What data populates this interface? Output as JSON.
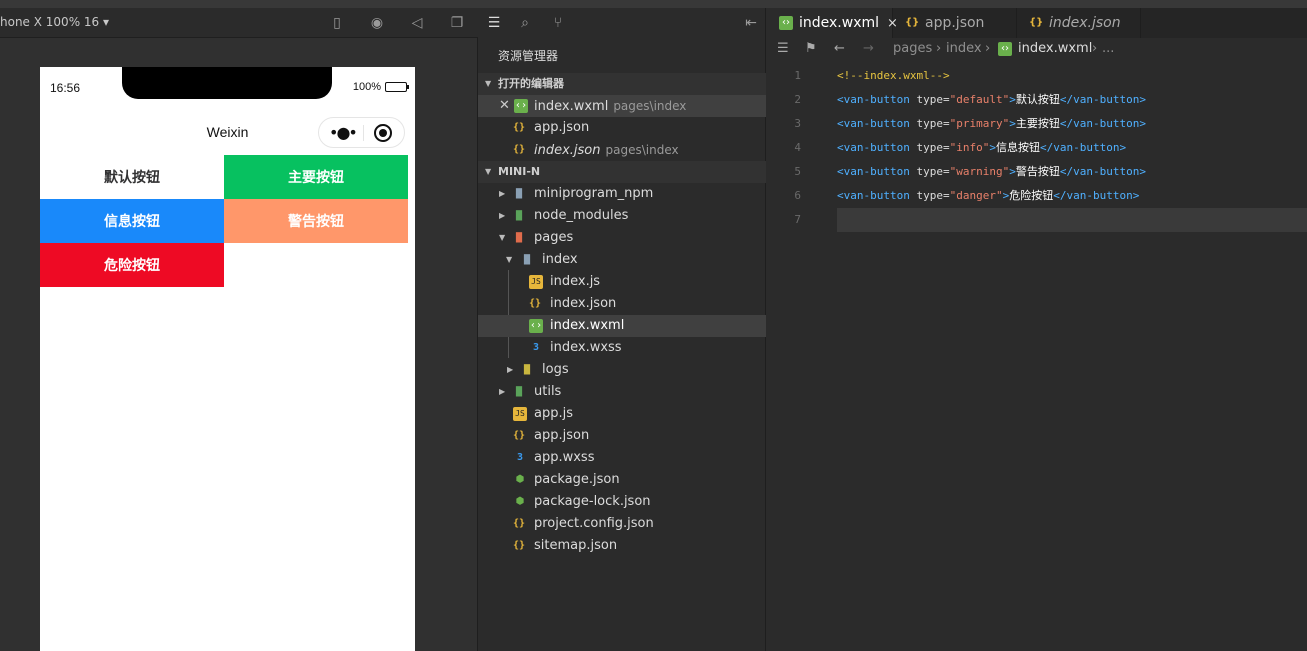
{
  "simulator": {
    "device_label": "hone X 100% 16 ▾",
    "status_time": "16:56",
    "status_battery": "100%",
    "nav_title": "Weixin",
    "buttons": {
      "default": "默认按钮",
      "primary": "主要按钮",
      "info": "信息按钮",
      "warning": "警告按钮",
      "danger": "危险按钮"
    }
  },
  "explorer": {
    "title": "资源管理器",
    "open_editors_header": "打开的编辑器",
    "open_editors": [
      {
        "name": "index.wxml",
        "path": "pages\\index"
      },
      {
        "name": "app.json",
        "path": ""
      },
      {
        "name": "index.json",
        "path": "pages\\index"
      }
    ],
    "project_header": "MINI-N",
    "tree": [
      {
        "name": "miniprogram_npm"
      },
      {
        "name": "node_modules"
      },
      {
        "name": "pages"
      },
      {
        "name": "index"
      },
      {
        "name": "index.js"
      },
      {
        "name": "index.json"
      },
      {
        "name": "index.wxml"
      },
      {
        "name": "index.wxss"
      },
      {
        "name": "logs"
      },
      {
        "name": "utils"
      },
      {
        "name": "app.js"
      },
      {
        "name": "app.json"
      },
      {
        "name": "app.wxss"
      },
      {
        "name": "package.json"
      },
      {
        "name": "package-lock.json"
      },
      {
        "name": "project.config.json"
      },
      {
        "name": "sitemap.json"
      }
    ]
  },
  "editor": {
    "tabs": [
      {
        "label": "index.wxml",
        "close": "×"
      },
      {
        "label": "app.json"
      },
      {
        "label": "index.json"
      }
    ],
    "breadcrumb": {
      "pages": "pages",
      "index": "index",
      "file": "index.wxml",
      "more": "..."
    },
    "lines": [
      {
        "no": "1",
        "comment": "<!--index.wxml-->"
      },
      {
        "no": "2",
        "open": "<van-button",
        "attr": " type=",
        "val": "\"default\"",
        "close": ">",
        "text": "默认按钮",
        "end": "</van-button>"
      },
      {
        "no": "3",
        "open": "<van-button",
        "attr": " type=",
        "val": "\"primary\"",
        "close": ">",
        "text": "主要按钮",
        "end": "</van-button>"
      },
      {
        "no": "4",
        "open": "<van-button",
        "attr": " type=",
        "val": "\"info\"",
        "close": ">",
        "text": "信息按钮",
        "end": "</van-button>"
      },
      {
        "no": "5",
        "open": "<van-button",
        "attr": " type=",
        "val": "\"warning\"",
        "close": ">",
        "text": "警告按钮",
        "end": "</van-button>"
      },
      {
        "no": "6",
        "open": "<van-button",
        "attr": " type=",
        "val": "\"danger\"",
        "close": ">",
        "text": "危险按钮",
        "end": "</van-button>"
      },
      {
        "no": "7"
      }
    ]
  },
  "colors": {
    "primary": "#07c160",
    "info": "#1989fa",
    "warning": "#ff976a",
    "danger": "#ee0a24"
  }
}
